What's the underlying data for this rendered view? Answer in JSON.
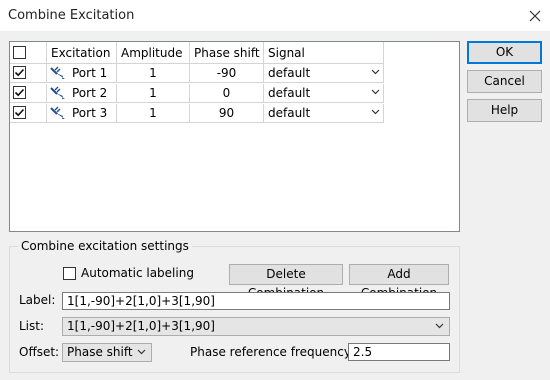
{
  "window": {
    "title": "Combine Excitation",
    "close_icon": "close-icon"
  },
  "table": {
    "columns": [
      "Excitation",
      "Amplitude",
      "Phase shift",
      "Signal"
    ],
    "select_all_checked": false,
    "rows": [
      {
        "checked": true,
        "excitation": "Port 1",
        "amplitude": "1",
        "phase": "-90",
        "signal": "default"
      },
      {
        "checked": true,
        "excitation": "Port 2",
        "amplitude": "1",
        "phase": "0",
        "signal": "default"
      },
      {
        "checked": true,
        "excitation": "Port 3",
        "amplitude": "1",
        "phase": "90",
        "signal": "default"
      }
    ],
    "row_icon": "port-icon"
  },
  "buttons": {
    "ok": "OK",
    "cancel": "Cancel",
    "help": "Help"
  },
  "settings": {
    "group_title": "Combine excitation settings",
    "auto_label_checkbox": "Automatic labeling",
    "auto_label_checked": false,
    "delete_button": "Delete Combination",
    "add_button": "Add Combination",
    "label_caption": "Label:",
    "label_value": "1[1,-90]+2[1,0]+3[1,90]",
    "list_caption": "List:",
    "list_value": "1[1,-90]+2[1,0]+3[1,90]",
    "offset_caption": "Offset:",
    "offset_value": "Phase shift",
    "phase_ref_caption": "Phase reference frequency:",
    "phase_ref_value": "2.5"
  },
  "colors": {
    "accent": "#0078d7",
    "port_icon": "#1e4e8c"
  }
}
